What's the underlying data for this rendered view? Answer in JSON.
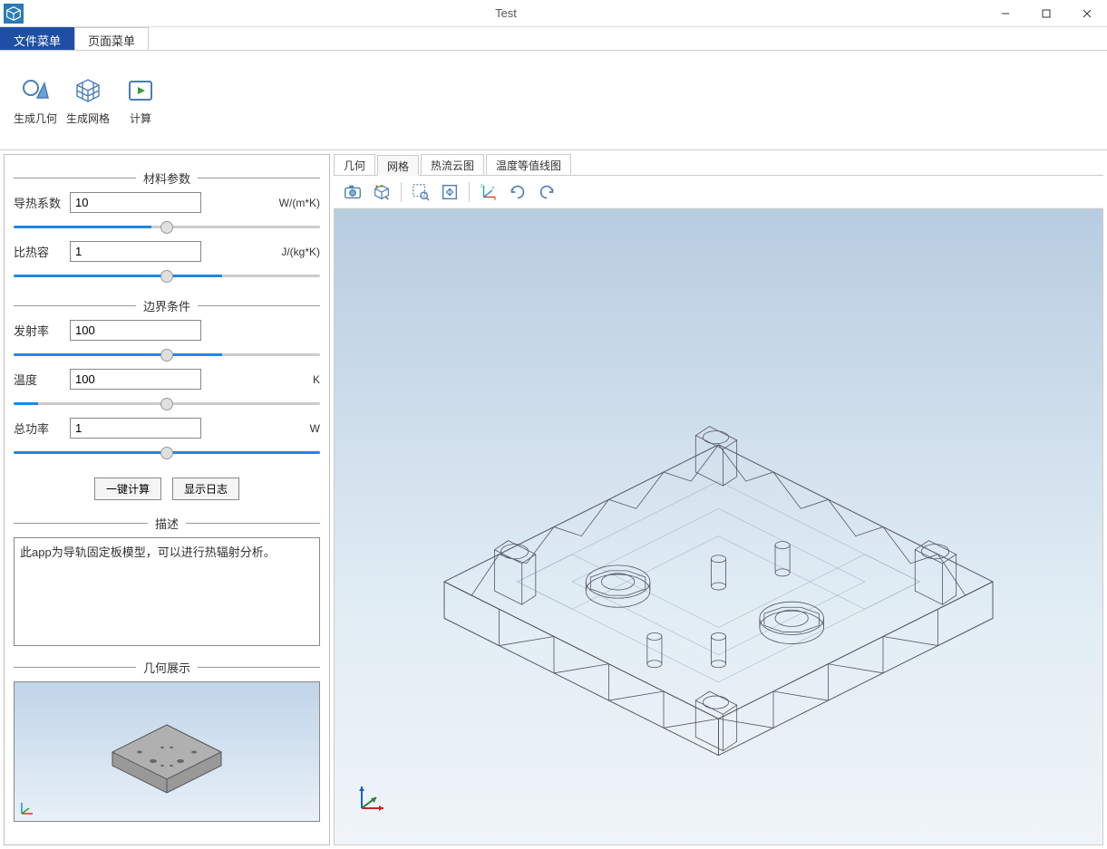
{
  "window": {
    "title": "Test"
  },
  "menu_tabs": {
    "file": "文件菜单",
    "page": "页面菜单"
  },
  "ribbon": {
    "geom": "生成几何",
    "mesh": "生成网格",
    "compute": "计算"
  },
  "sidebar": {
    "section_material": "材料参数",
    "section_boundary": "边界条件",
    "section_desc": "描述",
    "section_preview": "几何展示",
    "row_conductivity": {
      "label": "导热系数",
      "value": "10",
      "unit": "W/(m*K)"
    },
    "row_heatcap": {
      "label": "比热容",
      "value": "1",
      "unit": "J/(kg*K)"
    },
    "row_emissivity": {
      "label": "发射率",
      "value": "100",
      "unit": ""
    },
    "row_temperature": {
      "label": "温度",
      "value": "100",
      "unit": "K"
    },
    "row_power": {
      "label": "总功率",
      "value": "1",
      "unit": "W"
    },
    "btn_compute_all": "一键计算",
    "btn_show_log": "显示日志",
    "description_text": "此app为导轨固定板模型，可以进行热辐射分析。"
  },
  "view_tabs": {
    "geom": "几何",
    "mesh": "网格",
    "heatmap": "热流云图",
    "contour": "温度等值线图"
  },
  "toolbar_icons": {
    "screenshot": "camera-icon",
    "graphics": "cube-icon",
    "zoom_box": "zoom-box-icon",
    "zoom_extents": "expand-icon",
    "axes": "axis-icon",
    "rotate_cw": "rotate-cw-icon",
    "rotate_ccw": "rotate-ccw-icon"
  }
}
